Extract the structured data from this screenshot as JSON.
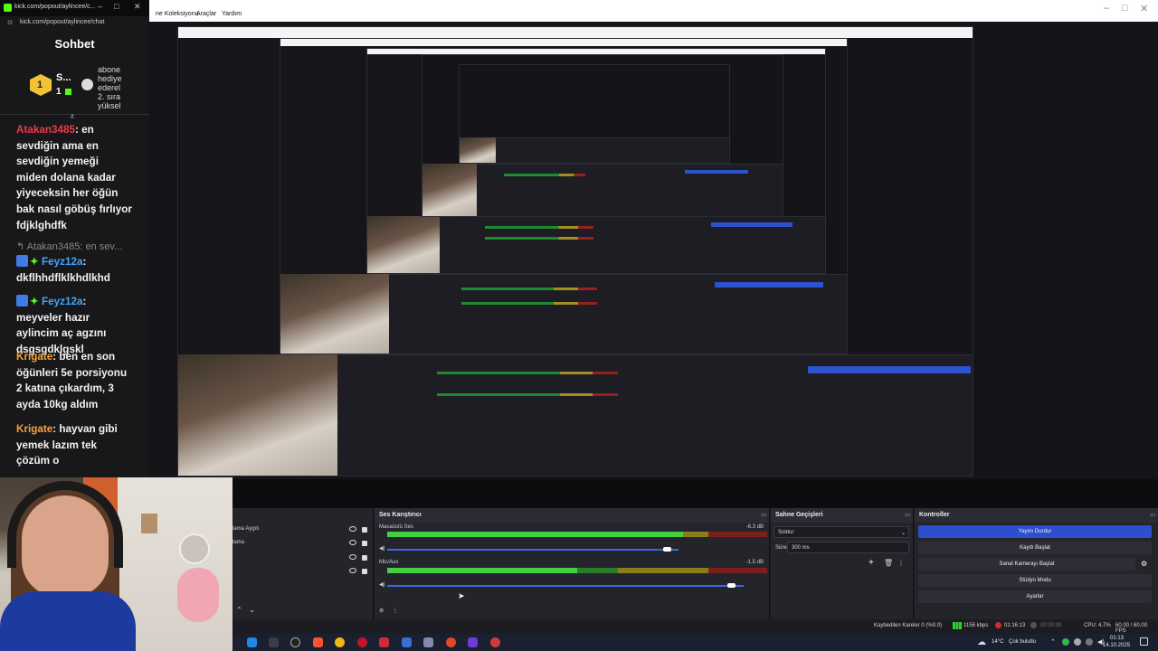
{
  "chat": {
    "window_url": "kick.com/popout/aylincee/c...",
    "address_url": "kick.com/popout/aylincee/chat",
    "title": "Sohbet",
    "pinned_user": "S...",
    "pinned_count": "1",
    "pinned_lines": [
      "abone",
      "hediye",
      "ederel",
      "2. sıra",
      "yüksel"
    ],
    "messages": [
      {
        "user": "Atakan3485",
        "text": ": en sevdiğin ama en sevdiğin yemeği miden dolana kadar yiyeceksin her öğün bak nasıl göbüş fırlıyor fdjklghdfk",
        "color": "red"
      },
      {
        "reply": "Atakan3485: en sev..."
      },
      {
        "user": "Feyz12a",
        "text": ": dkflhhdflklkhdlkhd",
        "color": "blue"
      },
      {
        "user": "Feyz12a",
        "text": ": meyveler hazır aylincim aç agzını dsgsgdklgskl",
        "color": "blue"
      },
      {
        "user": "Krigate",
        "text": ": ben en son öğünleri 5e porsiyonu 2 katına çıkardım, 3 ayda 10kg aldım",
        "color": "orange"
      },
      {
        "user": "Krigate",
        "text": ": hayvan gibi yemek lazım tek çözüm o",
        "color": "orange"
      }
    ]
  },
  "obs_menu": {
    "items": [
      "ne Koleksiyonu",
      "Araçlar",
      "Yardım"
    ]
  },
  "sources": {
    "items": [
      "lama Aygıtı",
      "lama"
    ]
  },
  "mixer": {
    "title": "Ses Karıştırıcı",
    "channels": [
      {
        "name": "Masaüstü Ses",
        "db": "-6.3 dB",
        "level": 0.78
      },
      {
        "name": "Mic/Aux",
        "db": "-1.5 dB",
        "level": 0.5
      }
    ],
    "scale": [
      "-60",
      "-55",
      "-50",
      "-45",
      "-40",
      "-35",
      "-30",
      "-25",
      "-20",
      "-15",
      "-10",
      "-5",
      "0"
    ]
  },
  "transitions": {
    "title": "Sahne Geçişleri",
    "selected": "Soldur",
    "duration_label": "Süre",
    "duration_value": "300 ms"
  },
  "controls": {
    "title": "Kontroller",
    "buttons": [
      "Yayını Durdur",
      "Kaydı Başlat",
      "Sanal Kamerayı Başlat",
      "Stüdyo Modu",
      "Ayarlar"
    ]
  },
  "status": {
    "dropped": "Kaybedilen Kareler 0 (%0.0)",
    "bitrate": "1156 kbps",
    "live_time": "01:16:13",
    "rec_time": "00:00:00",
    "cpu": "CPU: 4.7%",
    "fps": "60.00 / 60.00 FPS"
  },
  "taskbar": {
    "weather_temp": "14°C",
    "weather_desc": "Çok bulutlu",
    "time": "01:13",
    "date": "14.10.2025"
  }
}
